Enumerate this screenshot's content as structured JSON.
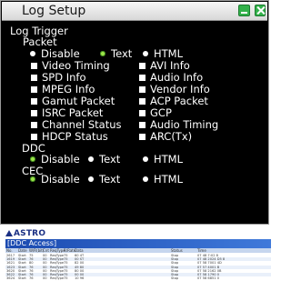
{
  "dialog": {
    "title": "Log Setup",
    "section_title": "Log Trigger",
    "packet": {
      "label": "Packet",
      "options": [
        "Disable",
        "Text",
        "HTML"
      ],
      "selected": "Text"
    },
    "checkboxes": {
      "left": [
        "Video Timing",
        "SPD Info",
        "MPEG Info",
        "Gamut Packet",
        "ISRC Packet",
        "Channel Status",
        "HDCP Status"
      ],
      "right": [
        "AVI Info",
        "Audio Info",
        "Vendor Info",
        "ACP Packet",
        "GCP",
        "Audio Timing",
        "ARC(Tx)"
      ]
    },
    "ddc": {
      "label": "DDC",
      "options": [
        "Disable",
        "Text",
        "HTML"
      ],
      "selected": "Disable"
    },
    "cec": {
      "label": "CEC",
      "options": [
        "Disable",
        "Text",
        "HTML"
      ],
      "selected": "Disable"
    }
  },
  "viewer": {
    "brand": "ASTRO",
    "section_title": "[DDC Access]",
    "headers": [
      "No.",
      "Date",
      "W/R(bit)",
      "Cnt",
      "ReqType",
      "R/Rate",
      "Data",
      "Status",
      "Time"
    ],
    "rows": [
      [
        "2617",
        "Start",
        "75",
        "00",
        "ReqType",
        "75",
        "60 4T",
        "Stop",
        "07 48 7:02 8"
      ],
      [
        "1619",
        "Start",
        "76",
        "00",
        "ReqType",
        "75",
        "00 ST",
        "Stop",
        "07 48 2024 D5 8"
      ],
      [
        "1621",
        "Start",
        "80",
        "00",
        "ReqType",
        "75",
        "82 00",
        "Stop",
        "07 58 7001 4D"
      ],
      [
        "1623",
        "Start",
        "76",
        "00",
        "ReqType",
        "75",
        "49 80",
        "Stop",
        "07 57 4001 B"
      ],
      [
        "3620",
        "Start",
        "76",
        "00",
        "ReqType",
        "75",
        "80 00",
        "Stop",
        "07 58 2162 0B"
      ],
      [
        "3622",
        "Start",
        "76",
        "00",
        "ReqType",
        "75",
        "00 00",
        "Stop",
        "07 58 1790 0"
      ],
      [
        "3624",
        "Start",
        "76",
        "00",
        "ReqType",
        "75",
        "10 96",
        "Stop",
        "07 58 6851 0"
      ]
    ]
  }
}
